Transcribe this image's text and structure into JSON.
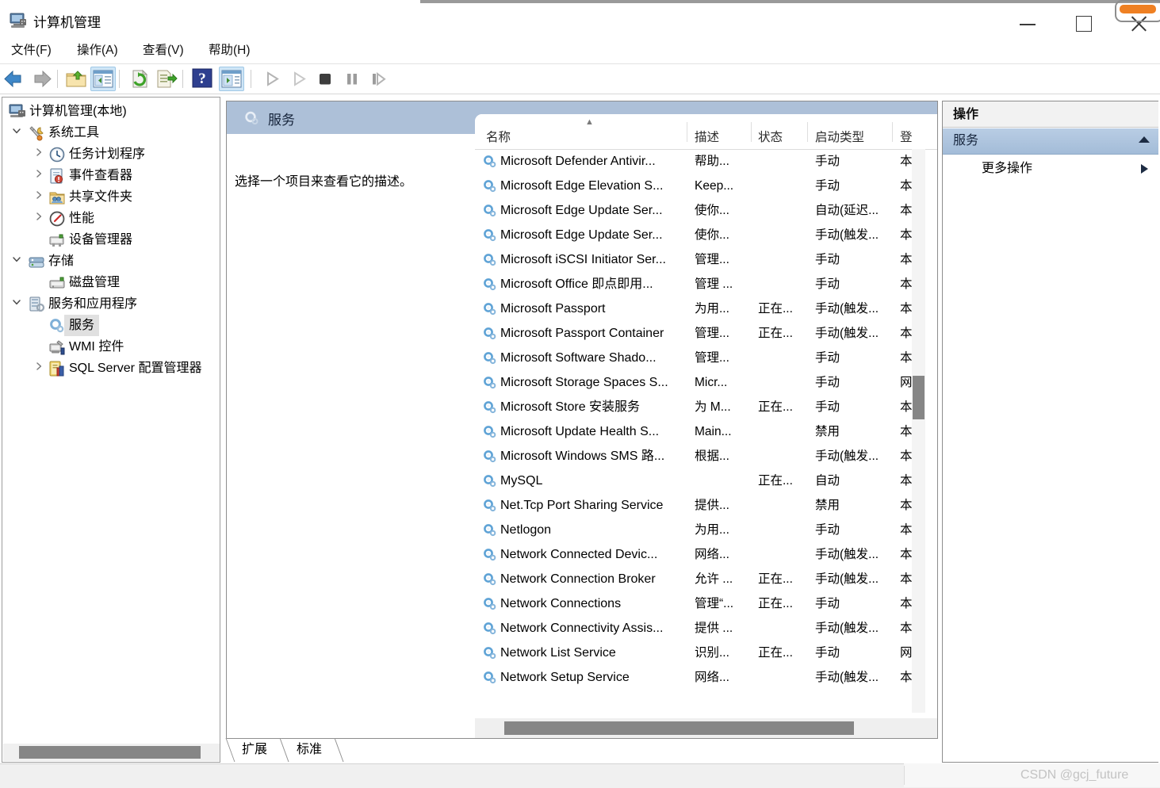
{
  "window": {
    "title": "计算机管理",
    "icon": "computer-management-icon",
    "controls": {
      "minimize": "—",
      "maximize": "□",
      "close": "✕"
    }
  },
  "menubar": {
    "items": [
      {
        "label": "文件(F)",
        "name": "menu-file"
      },
      {
        "label": "操作(A)",
        "name": "menu-action"
      },
      {
        "label": "查看(V)",
        "name": "menu-view"
      },
      {
        "label": "帮助(H)",
        "name": "menu-help"
      }
    ]
  },
  "toolbar": {
    "buttons": [
      {
        "icon": "back-arrow-icon",
        "active": false
      },
      {
        "icon": "forward-arrow-icon",
        "active": false
      },
      {
        "icon": "up-folder-icon",
        "active": false
      },
      {
        "icon": "show-hide-tree-icon",
        "active": true
      },
      {
        "icon": "refresh-icon",
        "active": false
      },
      {
        "icon": "export-list-icon",
        "active": false
      },
      {
        "icon": "help-icon",
        "active": false
      },
      {
        "icon": "show-hide-action-pane-icon",
        "active": true
      },
      {
        "icon": "start-service-icon",
        "active": false
      },
      {
        "icon": "play-all-icon",
        "active": false
      },
      {
        "icon": "stop-service-icon",
        "active": false
      },
      {
        "icon": "pause-service-icon",
        "active": false
      },
      {
        "icon": "restart-service-icon",
        "active": false
      }
    ]
  },
  "sidebar": {
    "items": [
      {
        "label": "计算机管理(本地)",
        "icon": "computer-icon",
        "depth": 0,
        "twisty": "",
        "selected": false
      },
      {
        "label": "系统工具",
        "icon": "system-tools-icon",
        "depth": 1,
        "twisty": "expanded",
        "selected": false
      },
      {
        "label": "任务计划程序",
        "icon": "task-scheduler-icon",
        "depth": 2,
        "twisty": "collapsed",
        "selected": false
      },
      {
        "label": "事件查看器",
        "icon": "event-viewer-icon",
        "depth": 2,
        "twisty": "collapsed",
        "selected": false
      },
      {
        "label": "共享文件夹",
        "icon": "shared-folders-icon",
        "depth": 2,
        "twisty": "collapsed",
        "selected": false
      },
      {
        "label": "性能",
        "icon": "performance-icon",
        "depth": 2,
        "twisty": "collapsed",
        "selected": false
      },
      {
        "label": "设备管理器",
        "icon": "device-manager-icon",
        "depth": 2,
        "twisty": "",
        "selected": false
      },
      {
        "label": "存储",
        "icon": "storage-icon",
        "depth": 1,
        "twisty": "expanded",
        "selected": false
      },
      {
        "label": "磁盘管理",
        "icon": "disk-management-icon",
        "depth": 2,
        "twisty": "",
        "selected": false
      },
      {
        "label": "服务和应用程序",
        "icon": "services-and-applications-icon",
        "depth": 1,
        "twisty": "expanded",
        "selected": false
      },
      {
        "label": "服务",
        "icon": "services-icon",
        "depth": 2,
        "twisty": "",
        "selected": true
      },
      {
        "label": "WMI 控件",
        "icon": "wmi-control-icon",
        "depth": 2,
        "twisty": "",
        "selected": false
      },
      {
        "label": "SQL Server 配置管理器",
        "icon": "sql-server-icon",
        "depth": 2,
        "twisty": "collapsed",
        "selected": false
      }
    ]
  },
  "center": {
    "banner_title": "服务",
    "banner_icon": "services-icon",
    "description_text": "选择一个项目来查看它的描述。",
    "columns": [
      {
        "label": "名称",
        "name": "column-name"
      },
      {
        "label": "描述",
        "name": "column-description"
      },
      {
        "label": "状态",
        "name": "column-status"
      },
      {
        "label": "启动类型",
        "name": "column-startup-type"
      },
      {
        "label": "登",
        "name": "column-logon-as"
      }
    ],
    "sort_indicator": "ascending",
    "rows": [
      {
        "name": "Microsoft Defender Antivir...",
        "desc": "帮助...",
        "state": "",
        "start": "手动",
        "logon": "本"
      },
      {
        "name": "Microsoft Edge Elevation S...",
        "desc": "Keep...",
        "state": "",
        "start": "手动",
        "logon": "本"
      },
      {
        "name": "Microsoft Edge Update Ser...",
        "desc": "使你...",
        "state": "",
        "start": "自动(延迟...",
        "logon": "本"
      },
      {
        "name": "Microsoft Edge Update Ser...",
        "desc": "使你...",
        "state": "",
        "start": "手动(触发...",
        "logon": "本"
      },
      {
        "name": "Microsoft iSCSI Initiator Ser...",
        "desc": "管理...",
        "state": "",
        "start": "手动",
        "logon": "本"
      },
      {
        "name": "Microsoft Office 即点即用...",
        "desc": "管理 ...",
        "state": "",
        "start": "手动",
        "logon": "本"
      },
      {
        "name": "Microsoft Passport",
        "desc": "为用...",
        "state": "正在...",
        "start": "手动(触发...",
        "logon": "本"
      },
      {
        "name": "Microsoft Passport Container",
        "desc": "管理...",
        "state": "正在...",
        "start": "手动(触发...",
        "logon": "本"
      },
      {
        "name": "Microsoft Software Shado...",
        "desc": "管理...",
        "state": "",
        "start": "手动",
        "logon": "本"
      },
      {
        "name": "Microsoft Storage Spaces S...",
        "desc": "Micr...",
        "state": "",
        "start": "手动",
        "logon": "网"
      },
      {
        "name": "Microsoft Store 安装服务",
        "desc": "为 M...",
        "state": "正在...",
        "start": "手动",
        "logon": "本"
      },
      {
        "name": "Microsoft Update Health S...",
        "desc": "Main...",
        "state": "",
        "start": "禁用",
        "logon": "本"
      },
      {
        "name": "Microsoft Windows SMS 路...",
        "desc": "根据...",
        "state": "",
        "start": "手动(触发...",
        "logon": "本"
      },
      {
        "name": "MySQL",
        "desc": "",
        "state": "正在...",
        "start": "自动",
        "logon": "本"
      },
      {
        "name": "Net.Tcp Port Sharing Service",
        "desc": "提供...",
        "state": "",
        "start": "禁用",
        "logon": "本"
      },
      {
        "name": "Netlogon",
        "desc": "为用...",
        "state": "",
        "start": "手动",
        "logon": "本"
      },
      {
        "name": "Network Connected Devic...",
        "desc": "网络...",
        "state": "",
        "start": "手动(触发...",
        "logon": "本"
      },
      {
        "name": "Network Connection Broker",
        "desc": "允许 ...",
        "state": "正在...",
        "start": "手动(触发...",
        "logon": "本"
      },
      {
        "name": "Network Connections",
        "desc": "管理“...",
        "state": "正在...",
        "start": "手动",
        "logon": "本"
      },
      {
        "name": "Network Connectivity Assis...",
        "desc": "提供 ...",
        "state": "",
        "start": "手动(触发...",
        "logon": "本"
      },
      {
        "name": "Network List Service",
        "desc": "识别...",
        "state": "正在...",
        "start": "手动",
        "logon": "网"
      },
      {
        "name": "Network Setup Service",
        "desc": "网络...",
        "state": "",
        "start": "手动(触发...",
        "logon": "本"
      }
    ],
    "tabs": [
      {
        "label": "扩展",
        "name": "tab-extended",
        "active": false
      },
      {
        "label": "标准",
        "name": "tab-standard",
        "active": true
      }
    ]
  },
  "actions": {
    "title": "操作",
    "group_label": "服务",
    "group_caret": "collapse-caret",
    "items": [
      {
        "label": "更多操作",
        "name": "action-more-actions",
        "caret": "submenu-caret"
      }
    ]
  },
  "statusbar": {
    "watermark": "CSDN @gcj_future"
  },
  "colors": {
    "banner_blue": "#adc0d8",
    "action_group_blue": "#a3bcd8",
    "toolbar_active": "#cfe6f7",
    "scrollbar_thumb": "#868686",
    "tree_selection": "#e0e0e0",
    "accent_orange": "#ef8023"
  }
}
